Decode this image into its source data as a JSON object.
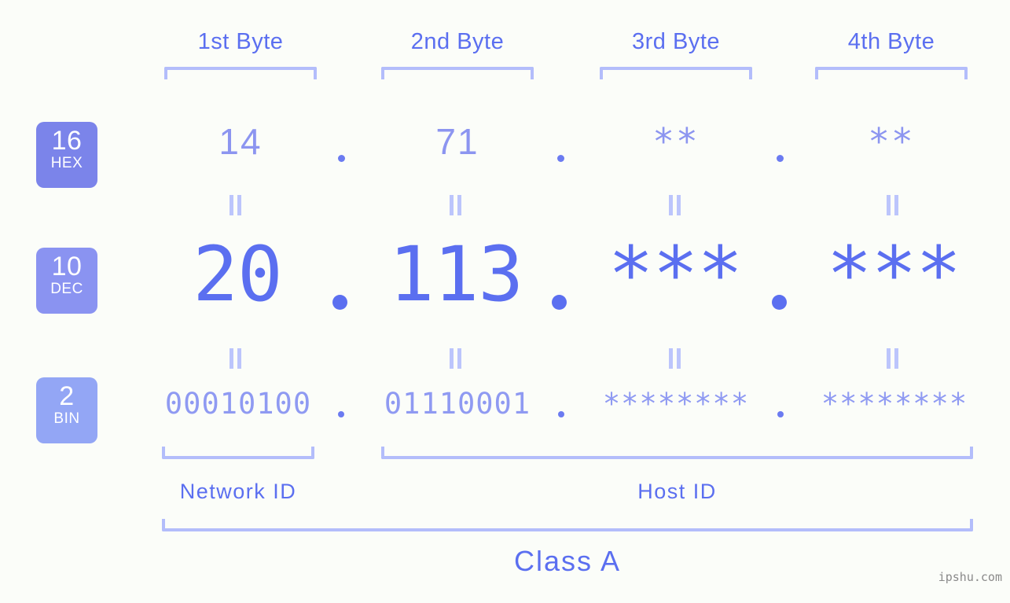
{
  "meta": {
    "background_color": "#fbfdf9",
    "accent_color": "#5b6ff0",
    "bracket_color": "#b3bdfb",
    "watermark": "ipshu.com"
  },
  "columns": [
    {
      "label": "1st Byte"
    },
    {
      "label": "2nd Byte"
    },
    {
      "label": "3rd Byte"
    },
    {
      "label": "4th Byte"
    }
  ],
  "rows": [
    {
      "badge_number": "16",
      "badge_name": "HEX",
      "badge_color": "#7b84ea",
      "values": [
        "14",
        "71",
        "**",
        "**"
      ]
    },
    {
      "badge_number": "10",
      "badge_name": "DEC",
      "badge_color": "#8a93f1",
      "values": [
        "20",
        "113",
        "***",
        "***"
      ]
    },
    {
      "badge_number": "2",
      "badge_name": "BIN",
      "badge_color": "#93a6f5",
      "values": [
        "00010100",
        "01110001",
        "********",
        "********"
      ]
    }
  ],
  "separators": {
    "equals_symbol": "||",
    "dot_symbol": "."
  },
  "regions": [
    {
      "label": "Network ID"
    },
    {
      "label": "Host ID"
    }
  ],
  "class": {
    "label": "Class A"
  }
}
